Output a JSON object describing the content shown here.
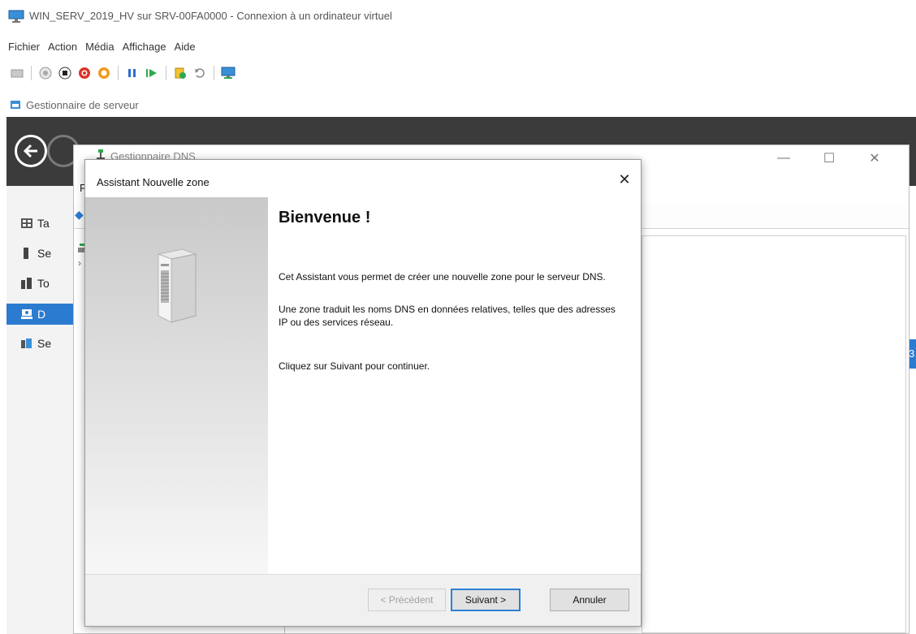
{
  "vm_window": {
    "title": "WIN_SERV_2019_HV sur SRV-00FA0000 - Connexion à un ordinateur virtuel",
    "menu": [
      "Fichier",
      "Action",
      "Média",
      "Affichage",
      "Aide"
    ]
  },
  "server_manager": {
    "title": "Gestionnaire de serveur",
    "nav": [
      {
        "label": "Ta",
        "icon": "dashboard-icon"
      },
      {
        "label": "Se",
        "icon": "server-icon"
      },
      {
        "label": "To",
        "icon": "all-servers-icon"
      },
      {
        "label": "D",
        "icon": "dns-icon",
        "selected": true
      },
      {
        "label": "Se",
        "icon": "file-services-icon"
      }
    ],
    "right_fragment": "3"
  },
  "dns_manager": {
    "title": "Gestionnaire DNS",
    "menu_fragment": "F"
  },
  "wizard": {
    "title": "Assistant Nouvelle zone",
    "heading": "Bienvenue !",
    "para1": "Cet Assistant vous permet de créer une nouvelle zone pour le serveur DNS.",
    "para2": "Une zone traduit les noms DNS en données relatives, telles que des adresses IP ou des services réseau.",
    "para3": "Cliquez sur Suivant pour continuer.",
    "buttons": {
      "back": "< Précédent",
      "next": "Suivant >",
      "cancel": "Annuler"
    }
  },
  "colors": {
    "accent": "#2b7bd0",
    "header_dark": "#3b3b3b"
  }
}
